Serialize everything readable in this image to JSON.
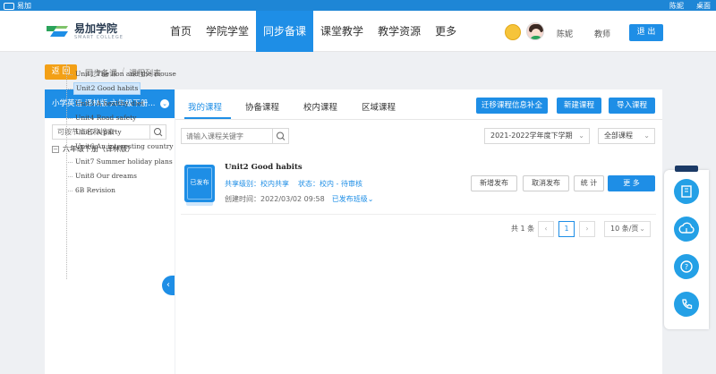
{
  "topbar": {
    "brand": "易加",
    "links": [
      "陈妮",
      "桌面"
    ]
  },
  "logo": {
    "cn": "易加学院",
    "en": "SMART COLLEGE"
  },
  "nav": [
    "首页",
    "学院学堂",
    "同步备课",
    "课堂教学",
    "教学资源",
    "更多"
  ],
  "user": {
    "name": "陈妮",
    "role": "教师",
    "logout": "退 出"
  },
  "breadcrumb": {
    "back": "返 回",
    "items": [
      "同步备课",
      "课程列表"
    ]
  },
  "sidebar": {
    "course": "小学英语·译林版·六年级下册...",
    "search_placeholder": "可按节点名称搜索",
    "root": "六年级下册（译林版）",
    "items": [
      "Unit1 The lion and the mouse",
      "Unit2 Good habits",
      "Unit3 A healthy diet",
      "Unit4 Road safety",
      "Unit5 A party",
      "Unit6 An interesting country",
      "Unit7 Summer holiday plans",
      "Unit8 Our dreams",
      "6B Revision"
    ]
  },
  "tabs": [
    "我的课程",
    "协备课程",
    "校内课程",
    "区域课程"
  ],
  "actions": [
    "迁移课程信息补全",
    "新建课程",
    "导入课程"
  ],
  "filters": {
    "search_placeholder": "请输入课程关键字",
    "term": "2021-2022学年度下学期",
    "scope": "全部课程"
  },
  "course": {
    "status_badge": "已发布",
    "title": "Unit2 Good habits",
    "share_level": "共享级别：校内共享",
    "state": "状态：校内 - 待审核",
    "created": "创建时间：2022/03/02 09:58",
    "published_classes": "已发布班级",
    "buttons": [
      "新增发布",
      "取消发布",
      "统 计",
      "更 多"
    ]
  },
  "pagination": {
    "total": "共 1 条",
    "current": "1",
    "page_size": "10 条/页",
    "prev": "‹",
    "next": "›"
  },
  "colors": {
    "primary": "#1e8ee6",
    "back": "#f3a016"
  }
}
